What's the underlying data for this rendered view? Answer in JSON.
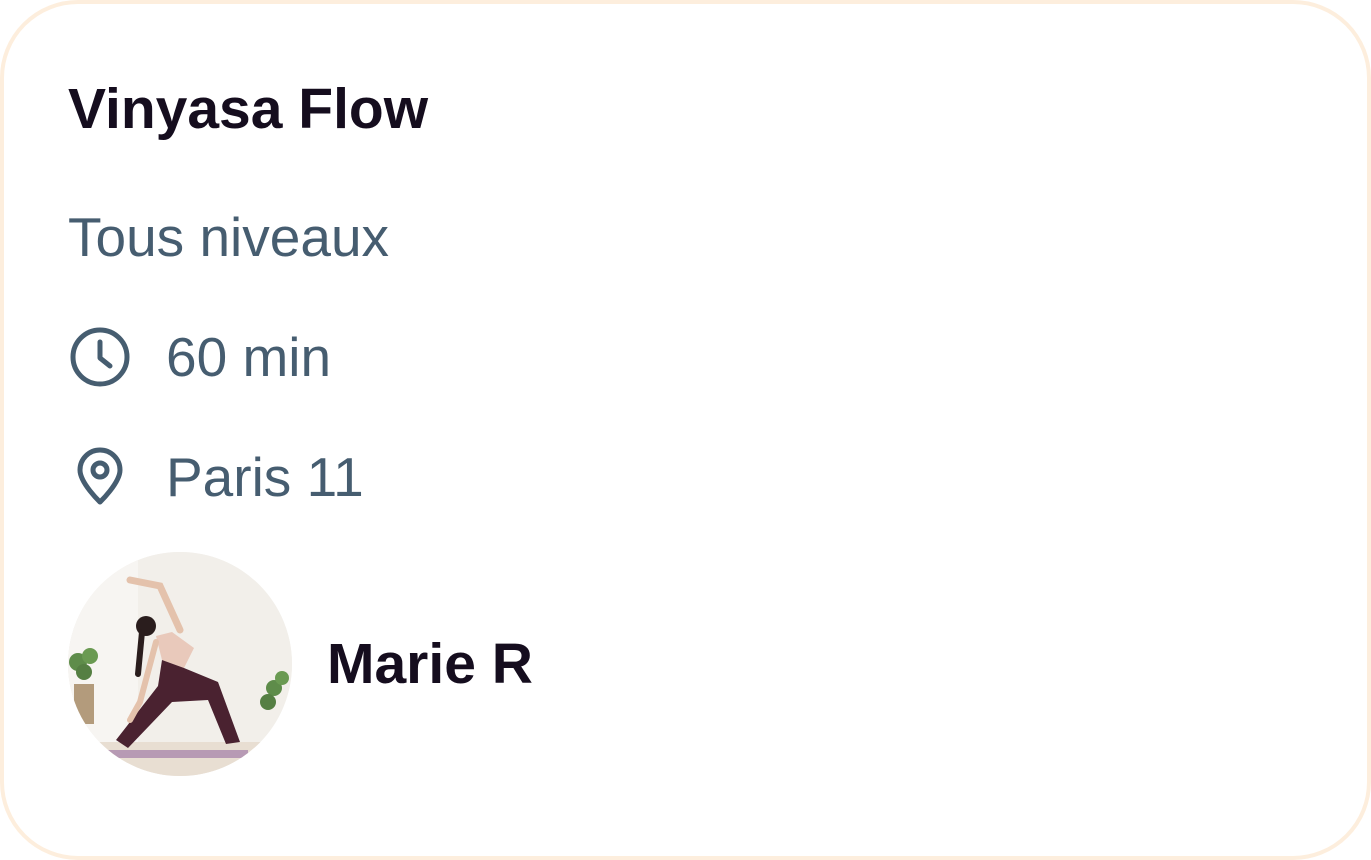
{
  "class_card": {
    "title": "Vinyasa Flow",
    "level": "Tous niveaux",
    "duration": {
      "icon": "clock-icon",
      "label": "60 min"
    },
    "location": {
      "icon": "map-pin-icon",
      "label": "Paris 11"
    },
    "instructor": {
      "name": "Marie R",
      "avatar": "yoga-pose-photo"
    }
  },
  "colors": {
    "title": "#150d1e",
    "secondary_text": "#465d70",
    "card_border": "#fdeedd",
    "background": "#ffffff"
  }
}
